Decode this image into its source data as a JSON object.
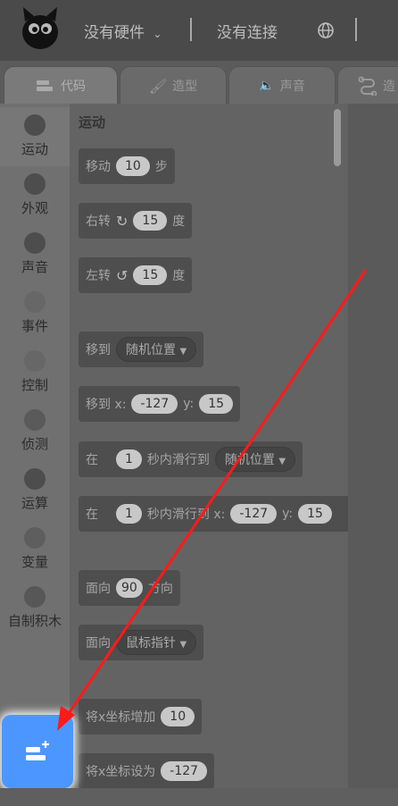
{
  "header": {
    "hardware_label": "没有硬件",
    "connection_label": "没有连接"
  },
  "tabs": [
    {
      "label": "代码",
      "active": true
    },
    {
      "label": "造型",
      "active": false
    },
    {
      "label": "声音",
      "active": false
    },
    {
      "label": "造",
      "active": false
    }
  ],
  "categories": [
    {
      "label": "运动"
    },
    {
      "label": "外观"
    },
    {
      "label": "声音"
    },
    {
      "label": "事件"
    },
    {
      "label": "控制"
    },
    {
      "label": "侦测"
    },
    {
      "label": "运算"
    },
    {
      "label": "变量"
    },
    {
      "label": "自制积木"
    }
  ],
  "palette": {
    "section_title": "运动",
    "blocks": {
      "move": {
        "pre": "移动",
        "value": "10",
        "post": "步"
      },
      "turn_right": {
        "pre": "右转",
        "value": "15",
        "post": "度"
      },
      "turn_left": {
        "pre": "左转",
        "value": "15",
        "post": "度"
      },
      "goto": {
        "pre": "移到",
        "dropdown": "随机位置"
      },
      "goto_xy": {
        "pre": "移到 x:",
        "x": "-127",
        "ylabel": "y:",
        "y": "15"
      },
      "glide_to": {
        "pre": "在",
        "value": "1",
        "mid": "秒内滑行到",
        "dropdown": "随机位置"
      },
      "glide_xy": {
        "pre": "在",
        "value": "1",
        "mid": "秒内滑行到 x:",
        "x": "-127",
        "ylabel": "y:",
        "y": "15"
      },
      "point_dir": {
        "pre": "面向",
        "value": "90",
        "post": "方向"
      },
      "point_to": {
        "pre": "面向",
        "dropdown": "鼠标指针"
      },
      "change_x": {
        "pre": "将x坐标增加",
        "value": "10"
      },
      "set_x": {
        "pre": "将x坐标设为",
        "value": "-127"
      }
    }
  },
  "colors": {
    "extension_button": "#4c97ff",
    "arrow": "#ff1a1a"
  }
}
